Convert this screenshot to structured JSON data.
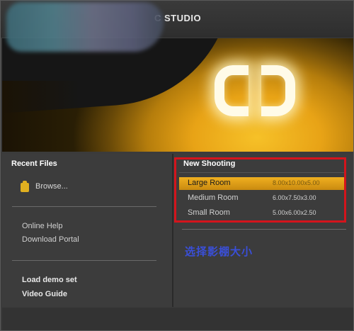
{
  "window": {
    "title": "C STUDIO"
  },
  "recent": {
    "heading": "Recent Files",
    "browse_label": "Browse..."
  },
  "links": {
    "online_help": "Online Help",
    "download_portal": "Download Portal",
    "load_demo": "Load demo set",
    "video_guide": "Video Guide"
  },
  "shooting": {
    "heading": "New Shooting",
    "rooms": [
      {
        "name": "Large Room",
        "dims": "8.00x10.00x5.00",
        "selected": true
      },
      {
        "name": "Medium Room",
        "dims": "6.00x7.50x3.00",
        "selected": false
      },
      {
        "name": "Small Room",
        "dims": "5.00x6.00x2.50",
        "selected": false
      }
    ]
  },
  "annotation": "选择影棚大小",
  "colors": {
    "accent": "#f0b020",
    "highlight_border": "#d4141c",
    "annotation_text": "#3a4fd8"
  }
}
